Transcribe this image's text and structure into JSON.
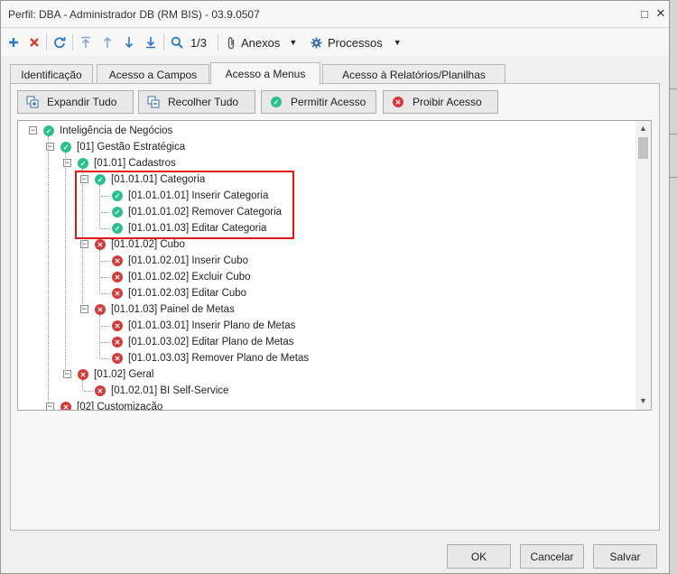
{
  "window": {
    "title": "Perfil: DBA - Administrador DB (RM BIS) - 03.9.0507",
    "maximize_icon": "□",
    "close_icon": "✕"
  },
  "toolbar": {
    "record_position": "1/3",
    "attachments_label": "Anexos",
    "processes_label": "Processos"
  },
  "tabs": [
    {
      "label": "Identificação",
      "active": false
    },
    {
      "label": "Acesso a Campos",
      "active": false
    },
    {
      "label": "Acesso a Menus",
      "active": true
    },
    {
      "label": "Acesso à Relatórios/Planilhas",
      "active": false
    }
  ],
  "actions": {
    "expand_all": "Expandir Tudo",
    "collapse_all": "Recolher Tudo",
    "allow_access": "Permitir Acesso",
    "deny_access": "Proibir Acesso"
  },
  "tree": [
    {
      "label": "Inteligência de Negócios",
      "level": 0,
      "status": "allowed",
      "expanded": true
    },
    {
      "label": "[01] Gestão Estratégica",
      "level": 1,
      "status": "allowed",
      "expanded": true
    },
    {
      "label": "[01.01] Cadastros",
      "level": 2,
      "status": "allowed",
      "expanded": true
    },
    {
      "label": "[01.01.01] Categoria",
      "level": 3,
      "status": "allowed",
      "expanded": true
    },
    {
      "label": "[01.01.01.01] Inserir Categoria",
      "level": 4,
      "status": "allowed"
    },
    {
      "label": "[01.01.01.02] Remover Categoria",
      "level": 4,
      "status": "allowed"
    },
    {
      "label": "[01.01.01.03] Editar Categoria",
      "level": 4,
      "status": "allowed"
    },
    {
      "label": "[01.01.02] Cubo",
      "level": 3,
      "status": "denied",
      "expanded": true
    },
    {
      "label": "[01.01.02.01] Inserir Cubo",
      "level": 4,
      "status": "denied"
    },
    {
      "label": "[01.01.02.02] Excluir Cubo",
      "level": 4,
      "status": "denied"
    },
    {
      "label": "[01.01.02.03] Editar Cubo",
      "level": 4,
      "status": "denied"
    },
    {
      "label": "[01.01.03] Painel de Metas",
      "level": 3,
      "status": "denied",
      "expanded": true
    },
    {
      "label": "[01.01.03.01] Inserir Plano de Metas",
      "level": 4,
      "status": "denied"
    },
    {
      "label": "[01.01.03.02] Editar Plano de Metas",
      "level": 4,
      "status": "denied"
    },
    {
      "label": "[01.01.03.03] Remover Plano de Metas",
      "level": 4,
      "status": "denied"
    },
    {
      "label": "[01.02] Geral",
      "level": 2,
      "status": "denied",
      "expanded": true
    },
    {
      "label": "[01.02.01] BI Self-Service",
      "level": 3,
      "status": "denied"
    },
    {
      "label": "[02] Customização",
      "level": 1,
      "status": "denied",
      "expanded": true
    }
  ],
  "footer": {
    "ok": "OK",
    "cancel": "Cancelar",
    "save": "Salvar"
  },
  "colors": {
    "allowed": "#2bbf8c",
    "denied": "#d33b3b",
    "highlight": "#e01515",
    "toolbar_icon": "#2b78c5"
  }
}
